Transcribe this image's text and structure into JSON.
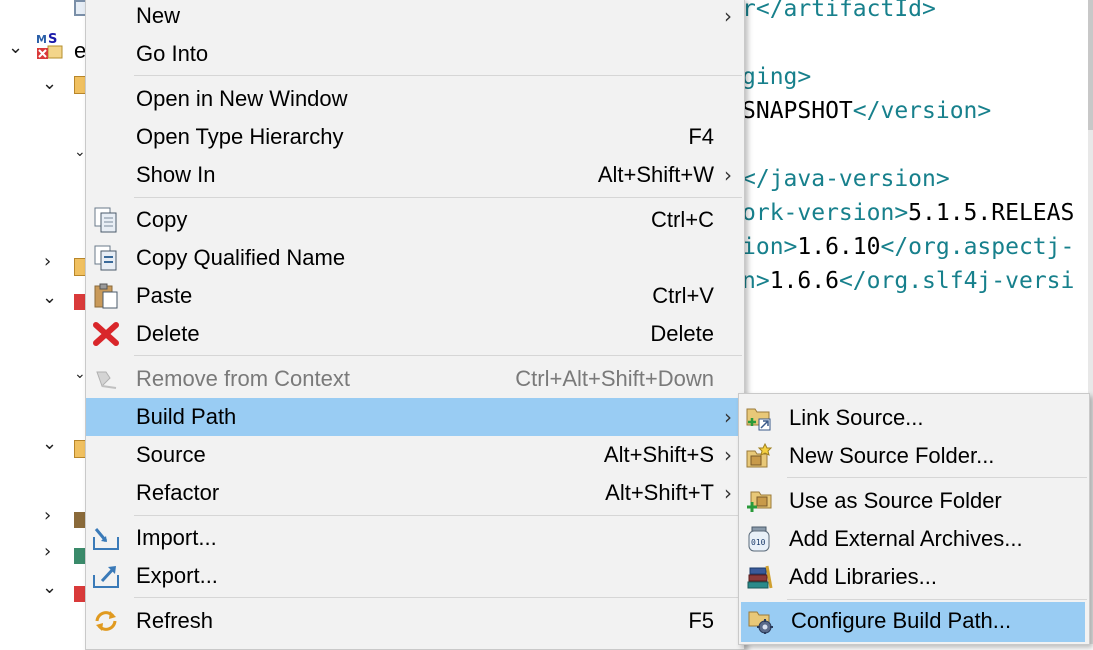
{
  "tree": {
    "row_label": "e"
  },
  "editor": {
    "lines": [
      {
        "parts": [
          {
            "t": "r",
            "c": "tag"
          },
          {
            "t": "</artifactId>",
            "c": "tag"
          }
        ]
      },
      {
        "parts": []
      },
      {
        "parts": [
          {
            "t": "ging>",
            "c": "tag"
          }
        ]
      },
      {
        "parts": [
          {
            "t": "SNAPSHOT",
            "c": "txt"
          },
          {
            "t": "</version>",
            "c": "tag"
          }
        ]
      },
      {
        "parts": []
      },
      {
        "parts": [
          {
            "t": "</java-version>",
            "c": "tag"
          }
        ]
      },
      {
        "parts": [
          {
            "t": "ork-version>",
            "c": "tag"
          },
          {
            "t": "5.1.5.RELEAS",
            "c": "txt"
          }
        ]
      },
      {
        "parts": [
          {
            "t": "ion>",
            "c": "tag"
          },
          {
            "t": "1.6.10",
            "c": "txt"
          },
          {
            "t": "</org.aspectj-",
            "c": "tag"
          }
        ]
      },
      {
        "parts": [
          {
            "t": "n>",
            "c": "tag"
          },
          {
            "t": "1.6.6",
            "c": "txt"
          },
          {
            "t": "</org.slf4j-versi",
            "c": "tag"
          }
        ]
      }
    ]
  },
  "context_menu": {
    "items": [
      {
        "label": "New",
        "shortcut": "",
        "submenu": true,
        "icon": ""
      },
      {
        "label": "Go Into",
        "shortcut": "",
        "submenu": false,
        "icon": ""
      },
      {
        "label": "Open in New Window",
        "shortcut": "",
        "submenu": false,
        "icon": ""
      },
      {
        "label": "Open Type Hierarchy",
        "shortcut": "F4",
        "submenu": false,
        "icon": ""
      },
      {
        "label": "Show In",
        "shortcut": "Alt+Shift+W",
        "submenu": true,
        "icon": ""
      },
      {
        "label": "Copy",
        "shortcut": "Ctrl+C",
        "submenu": false,
        "icon": "copy-icon"
      },
      {
        "label": "Copy Qualified Name",
        "shortcut": "",
        "submenu": false,
        "icon": "copy-qualified-name-icon"
      },
      {
        "label": "Paste",
        "shortcut": "Ctrl+V",
        "submenu": false,
        "icon": "paste-icon"
      },
      {
        "label": "Delete",
        "shortcut": "Delete",
        "submenu": false,
        "icon": "delete-icon"
      },
      {
        "label": "Remove from Context",
        "shortcut": "Ctrl+Alt+Shift+Down",
        "submenu": false,
        "icon": "remove-from-context-icon",
        "disabled": true
      },
      {
        "label": "Build Path",
        "shortcut": "",
        "submenu": true,
        "icon": "",
        "selected": true
      },
      {
        "label": "Source",
        "shortcut": "Alt+Shift+S",
        "submenu": true,
        "icon": ""
      },
      {
        "label": "Refactor",
        "shortcut": "Alt+Shift+T",
        "submenu": true,
        "icon": ""
      },
      {
        "label": "Import...",
        "shortcut": "",
        "submenu": false,
        "icon": "import-icon"
      },
      {
        "label": "Export...",
        "shortcut": "",
        "submenu": false,
        "icon": "export-icon"
      },
      {
        "label": "Refresh",
        "shortcut": "F5",
        "submenu": false,
        "icon": "refresh-icon"
      }
    ]
  },
  "build_path_submenu": {
    "items": [
      {
        "label": "Link Source...",
        "icon": "link-source-icon"
      },
      {
        "label": "New Source Folder...",
        "icon": "new-source-folder-icon"
      },
      {
        "label": "Use as Source Folder",
        "icon": "use-as-source-folder-icon"
      },
      {
        "label": "Add External Archives...",
        "icon": "jar-archive-icon"
      },
      {
        "label": "Add Libraries...",
        "icon": "libraries-icon"
      },
      {
        "label": "Configure Build Path...",
        "icon": "configure-build-path-icon",
        "selected": true
      }
    ]
  },
  "colors": {
    "selection": "#99ccf3",
    "menu_background": "#f2f2f2",
    "xml_tag": "#17808c"
  }
}
